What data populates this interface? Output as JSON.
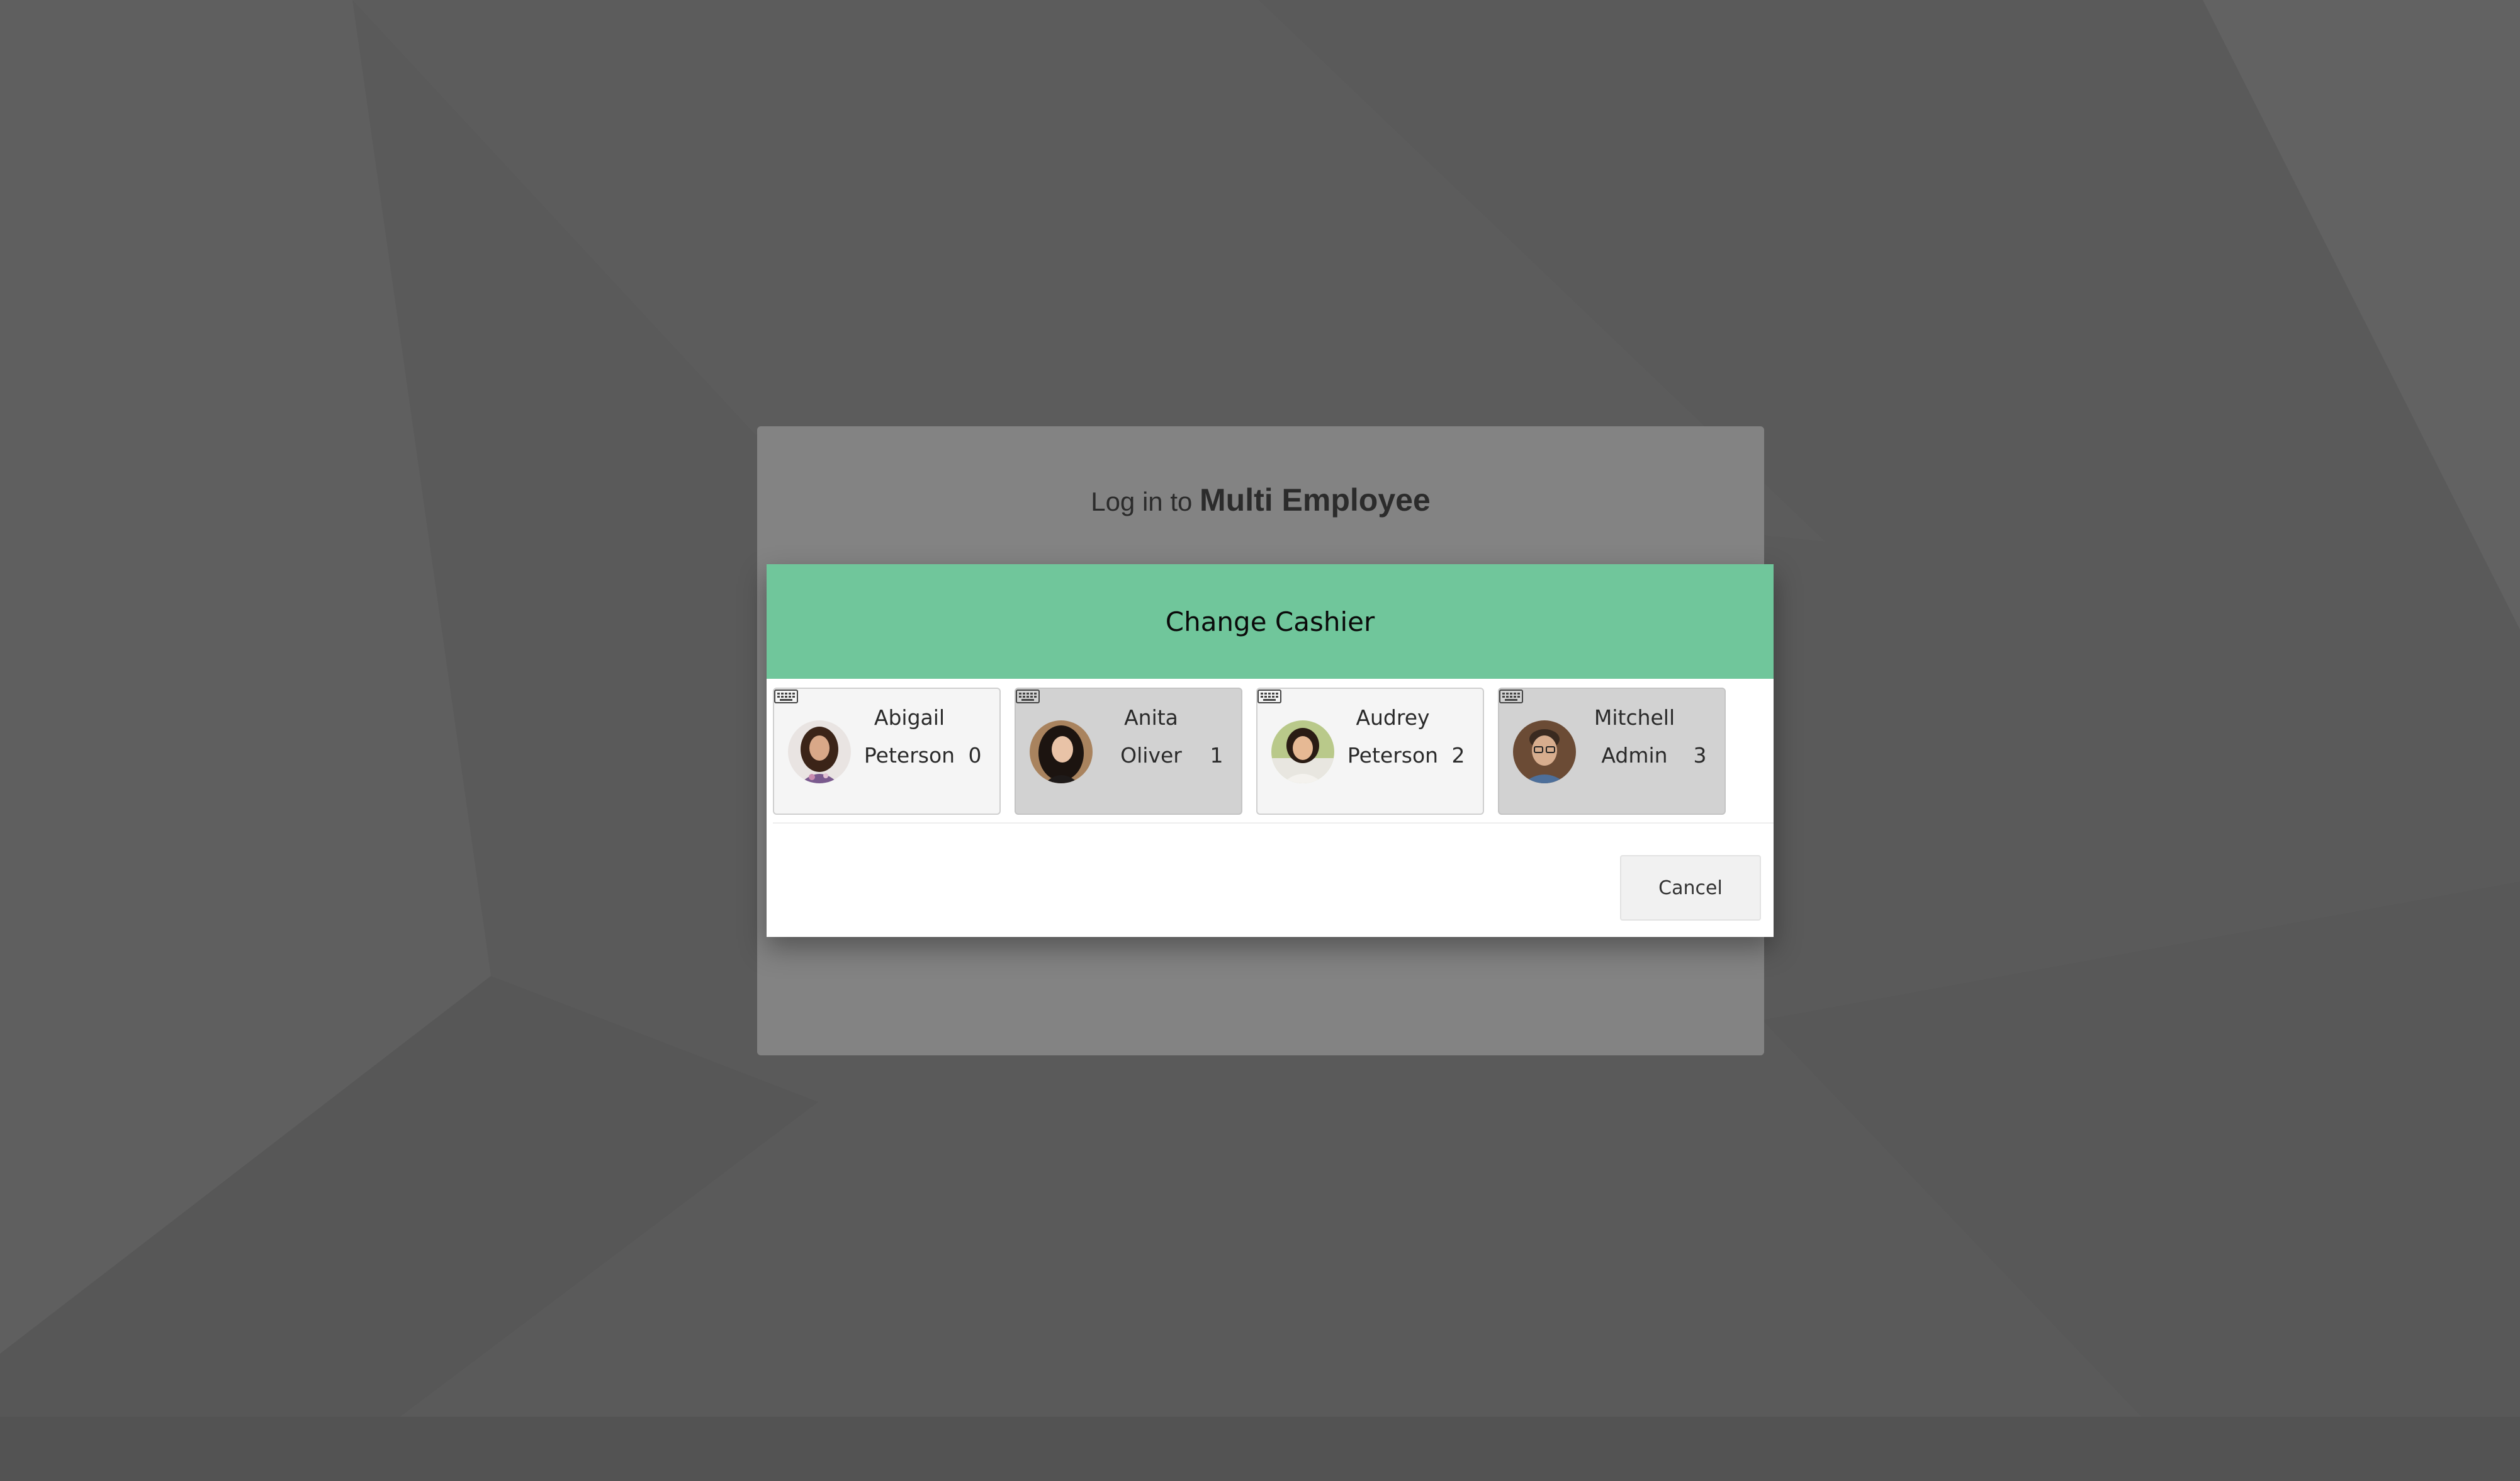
{
  "login": {
    "prefix": "Log in to",
    "company": "Multi Employee"
  },
  "dialog": {
    "title": "Change Cashier",
    "cancel_label": "Cancel"
  },
  "cashiers": [
    {
      "first_name": "Abigail",
      "last_name": "Peterson",
      "number": "0",
      "icon": "keyboard-icon"
    },
    {
      "first_name": "Anita",
      "last_name": "Oliver",
      "number": "1",
      "icon": "keyboard-icon"
    },
    {
      "first_name": "Audrey",
      "last_name": "Peterson",
      "number": "2",
      "icon": "keyboard-icon"
    },
    {
      "first_name": "Mitchell",
      "last_name": "Admin",
      "number": "3",
      "icon": "keyboard-icon"
    }
  ],
  "colors": {
    "header": "#70c69b",
    "overlay": "#5a5a5a"
  }
}
